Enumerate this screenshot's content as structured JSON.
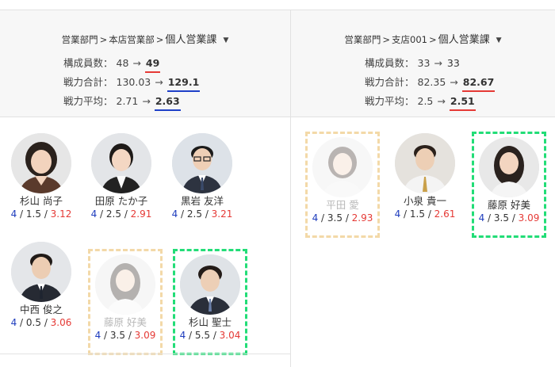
{
  "columns": [
    {
      "breadcrumb": [
        "営業部門",
        "本店営業部",
        "個人営業課"
      ],
      "breadcrumb_sep": ">",
      "stats": [
        {
          "label": "構成員数：",
          "old": "48",
          "arrow": "→",
          "new": "49",
          "underline": "red"
        },
        {
          "label": "戦力合計：",
          "old": "130.03",
          "arrow": "→",
          "new": "129.1",
          "underline": "blue"
        },
        {
          "label": "戦力平均：",
          "old": "2.71",
          "arrow": "→",
          "new": "2.63",
          "underline": "blue"
        }
      ],
      "members": [
        {
          "name": "杉山 尚子",
          "a": "4",
          "b": "1.5",
          "c": "3.12",
          "state": "normal",
          "avatar": "woman-short-hair"
        },
        {
          "name": "田原 たか子",
          "a": "4",
          "b": "2.5",
          "c": "2.91",
          "state": "normal",
          "avatar": "woman-ponytail"
        },
        {
          "name": "黒岩 友洋",
          "a": "4",
          "b": "2.5",
          "c": "3.21",
          "state": "normal",
          "avatar": "man-glasses"
        },
        {
          "name": "中西 俊之",
          "a": "4",
          "b": "0.5",
          "c": "3.06",
          "state": "normal",
          "avatar": "man-suit"
        },
        {
          "name": "藤原 好美",
          "a": "4",
          "b": "3.5",
          "c": "3.09",
          "state": "removed",
          "avatar": "woman-long-hair"
        },
        {
          "name": "杉山 聖士",
          "a": "4",
          "b": "5.5",
          "c": "3.04",
          "state": "added",
          "avatar": "man-young"
        }
      ]
    },
    {
      "breadcrumb": [
        "営業部門",
        "支店001",
        "個人営業課"
      ],
      "breadcrumb_sep": ">",
      "stats": [
        {
          "label": "構成員数：",
          "old": "33",
          "arrow": "→",
          "new": "33",
          "underline": "none"
        },
        {
          "label": "戦力合計：",
          "old": "82.35",
          "arrow": "→",
          "new": "82.67",
          "underline": "red"
        },
        {
          "label": "戦力平均：",
          "old": "2.5",
          "arrow": "→",
          "new": "2.51",
          "underline": "red"
        }
      ],
      "members": [
        {
          "name": "平田 愛",
          "a": "4",
          "b": "3.5",
          "c": "2.93",
          "state": "removed",
          "avatar": "woman-bob"
        },
        {
          "name": "小泉 貴一",
          "a": "4",
          "b": "1.5",
          "c": "2.61",
          "state": "normal",
          "avatar": "man-tie"
        },
        {
          "name": "藤原 好美",
          "a": "4",
          "b": "3.5",
          "c": "3.09",
          "state": "added",
          "avatar": "woman-long-hair"
        }
      ]
    }
  ],
  "colors": {
    "metric_a": "#1e3cbd",
    "metric_c": "#e53935",
    "removed_outline": "#f3d9a8",
    "added_outline": "#22dd77"
  }
}
